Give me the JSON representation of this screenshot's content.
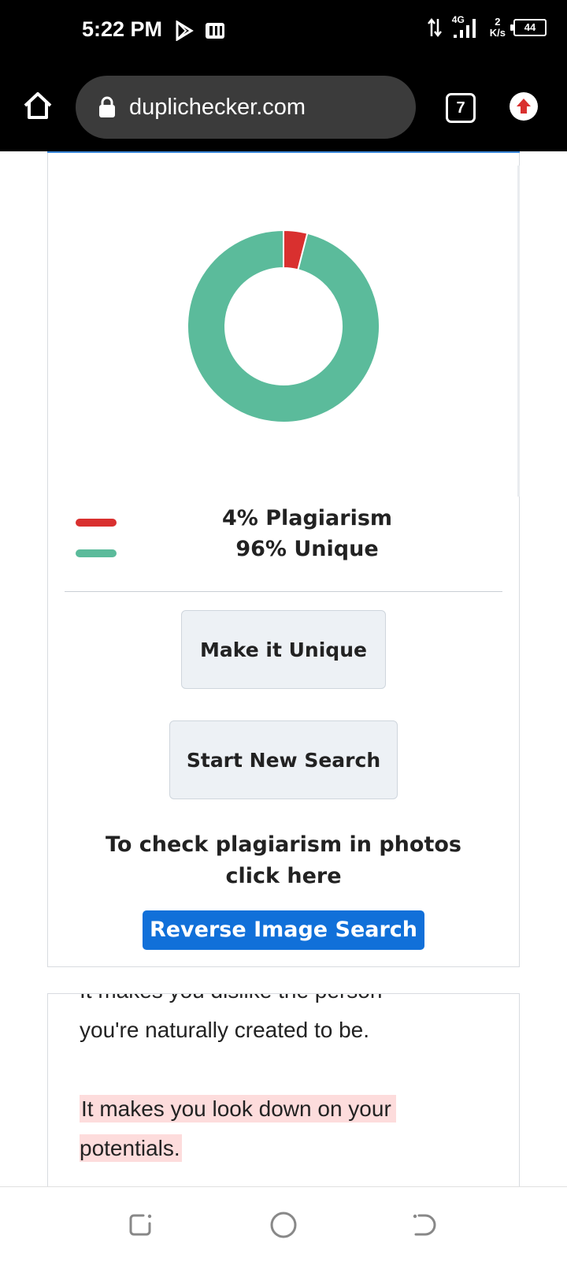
{
  "status_bar": {
    "time": "5:22 PM",
    "network": "4G",
    "speed_value": "2",
    "speed_unit": "K/s",
    "battery": "44"
  },
  "browser": {
    "url": "duplichecker.com",
    "tab_count": "7"
  },
  "result": {
    "chart_data": {
      "type": "pie",
      "categories": [
        "Plagiarism",
        "Unique"
      ],
      "values": [
        4,
        96
      ],
      "colors": [
        "#d9302f",
        "#5bbb9b"
      ]
    },
    "legend": [
      {
        "label": "4% Plagiarism",
        "color": "#d9302f"
      },
      {
        "label": "96% Unique",
        "color": "#5bbb9b"
      }
    ],
    "make_unique_label": "Make it Unique",
    "new_search_label": "Start New Search",
    "photo_line1": "To check plagiarism in photos",
    "photo_line2": "click here",
    "reverse_image_label": "Reverse Image Search"
  },
  "content": {
    "partial_line": "It makes you dislike the person",
    "line1": "you're naturally created to be.",
    "highlight_line1": "It makes you look down on your",
    "highlight_line2": "potentials."
  },
  "nav": {
    "icons": [
      "recents-icon",
      "home-circle-icon",
      "back-icon"
    ]
  }
}
